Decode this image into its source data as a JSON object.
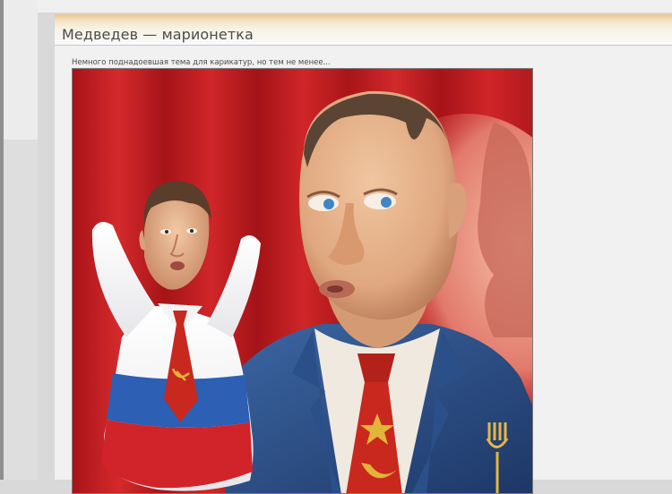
{
  "post": {
    "title": "Медведев — марионетка",
    "intro": "Немного поднадоевшая тема для карикатур, но тем не менее..."
  },
  "image": {
    "depicts": "caricature-putin-with-medvedev-hand-puppet",
    "colors": {
      "curtain": "#c21a1e",
      "skin": "#e7b48c",
      "suit": "#2a4d82",
      "shirt": "#f1ece2",
      "tie": "#c8281e",
      "emblem": "#e2b43a",
      "flag_white": "#f2f2f2",
      "flag_blue": "#2d5fb4",
      "flag_red": "#d0242a"
    }
  }
}
